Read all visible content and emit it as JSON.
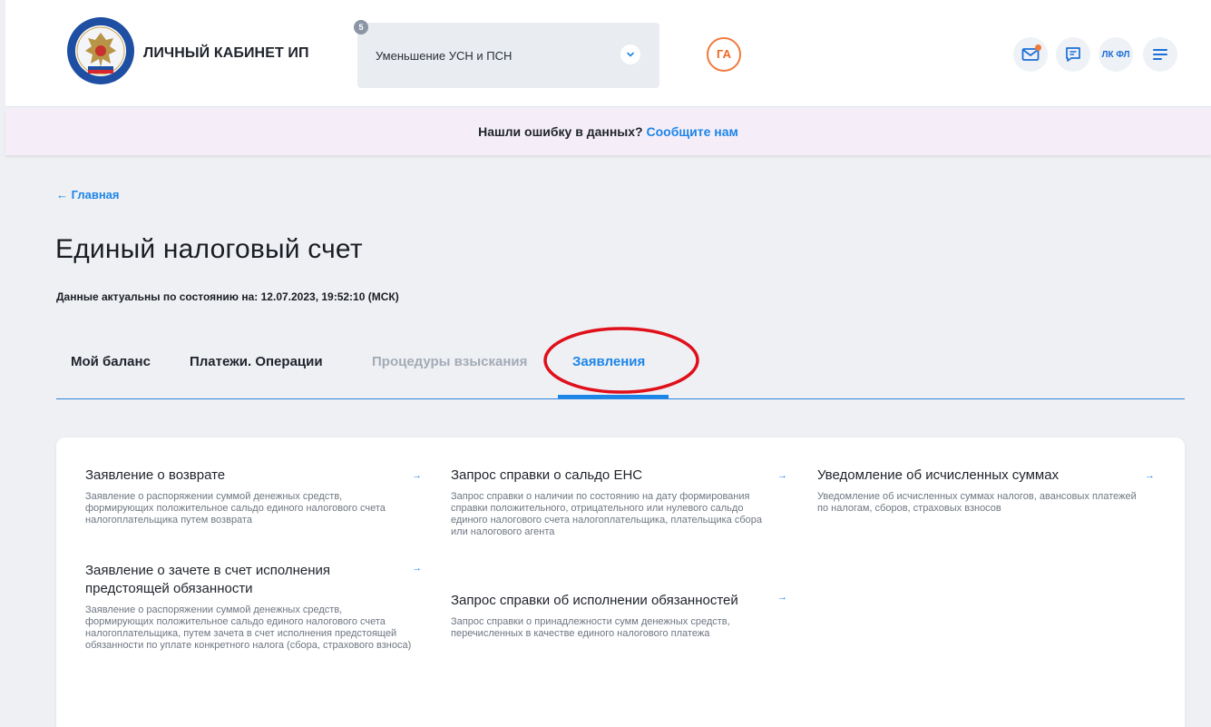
{
  "header": {
    "brand": "ЛИЧНЫЙ КАБИНЕТ ИП",
    "logo_icon": "fns-emblem-icon",
    "select": {
      "badge": "5",
      "value": "Уменьшение УСН и ПСН"
    },
    "avatar": "ГА",
    "icons": [
      "mail-icon",
      "chat-icon",
      "lkfl-icon",
      "menu-icon"
    ],
    "lkfl_label": "ЛК ФЛ"
  },
  "banner": {
    "question": "Нашли ошибку в данных?",
    "link": "Сообщите нам"
  },
  "breadcrumb": {
    "back": "← Главная"
  },
  "page": {
    "title": "Единый налоговый счет",
    "updated": "Данные актуальны по состоянию на: 12.07.2023, 19:52:10 (МСК)"
  },
  "tabs": [
    {
      "label": "Мой баланс"
    },
    {
      "label": "Платежи. Операции"
    },
    {
      "label": "Процедуры взыскания"
    },
    {
      "label": "Заявления"
    }
  ],
  "active_tab": "Заявления",
  "items": [
    {
      "title": "Заявление о возврате",
      "desc": "Заявление о распоряжении суммой денежных средств, формирующих положительное сальдо единого налогового счета налогоплательщика путем возврата"
    },
    {
      "title": "Заявление о зачете в счет исполнения предстоящей обязанности",
      "desc": "Заявление о распоряжении суммой денежных средств, формирующих положительное сальдо единого налогового счета налогоплательщика, путем зачета в счет исполнения предстоящей обязанности по уплате конкретного налога (сбора, страхового взноса)"
    },
    {
      "title": "Запрос справки о сальдо ЕНС",
      "desc": "Запрос справки о наличии по состоянию на дату формирования справки положительного, отрицательного или нулевого сальдо единого налогового счета налогоплательщика, плательщика сбора или налогового агента"
    },
    {
      "title": "Запрос справки об исполнении обязанностей",
      "desc": "Запрос справки о принадлежности сумм денежных средств, перечисленных в качестве единого налогового платежа"
    },
    {
      "title": "Уведомление об исчисленных суммах",
      "desc": "Уведомление об исчисленных суммах налогов, авансовых платежей по налогам, сборов, страховых взносов"
    }
  ],
  "arrow": "→",
  "colors": {
    "accent": "#1c85e8",
    "avatar": "#f07a3c",
    "annotation": "#e0101a"
  }
}
